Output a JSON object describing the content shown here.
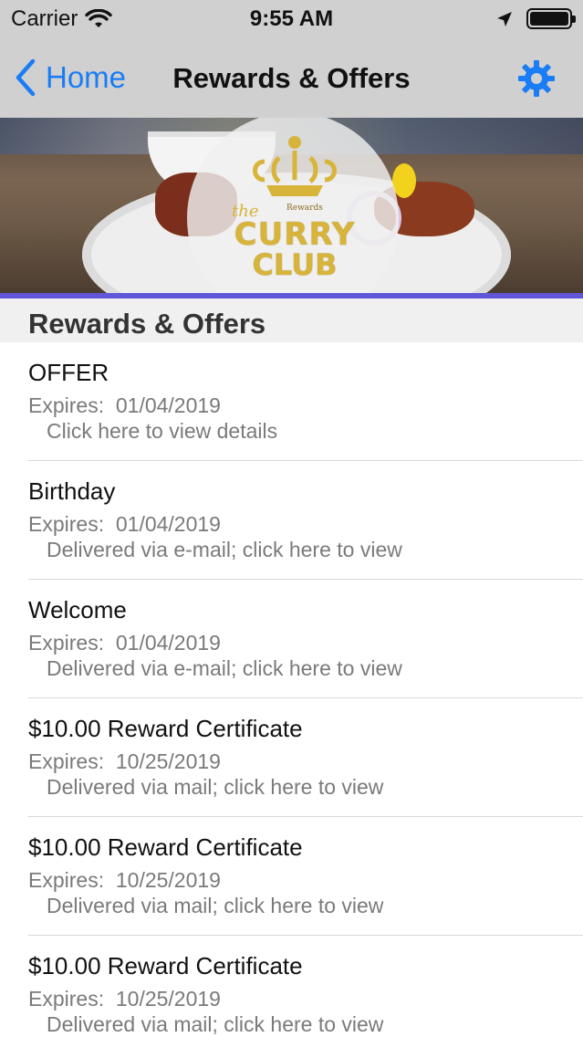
{
  "status_bar": {
    "carrier": "Carrier",
    "time": "9:55 AM"
  },
  "nav": {
    "back_label": "Home",
    "title": "Rewards & Offers",
    "accent_color": "#1a7df5"
  },
  "hero": {
    "logo_the": "the",
    "logo_rewards": "Rewards",
    "logo_line1": "CURRY",
    "logo_line2": "CLUB",
    "accent_color": "#6155d9"
  },
  "section": {
    "title": "Rewards & Offers"
  },
  "items": [
    {
      "title": "OFFER",
      "expires": "Expires:  01/04/2019",
      "detail": "Click here to view details"
    },
    {
      "title": "Birthday",
      "expires": "Expires:  01/04/2019",
      "detail": "Delivered via e-mail; click here to view"
    },
    {
      "title": "Welcome",
      "expires": "Expires:  01/04/2019",
      "detail": "Delivered via e-mail; click here to view"
    },
    {
      "title": "$10.00 Reward Certificate",
      "expires": "Expires:  10/25/2019",
      "detail": "Delivered via mail; click here to view"
    },
    {
      "title": "$10.00 Reward Certificate",
      "expires": "Expires:  10/25/2019",
      "detail": "Delivered via mail; click here to view"
    },
    {
      "title": "$10.00 Reward Certificate",
      "expires": "Expires:  10/25/2019",
      "detail": "Delivered via mail; click here to view"
    }
  ],
  "icons": {
    "wifi": "wifi-icon",
    "location": "location-arrow-icon",
    "battery": "battery-icon",
    "back": "chevron-left-icon",
    "settings": "gear-icon"
  }
}
